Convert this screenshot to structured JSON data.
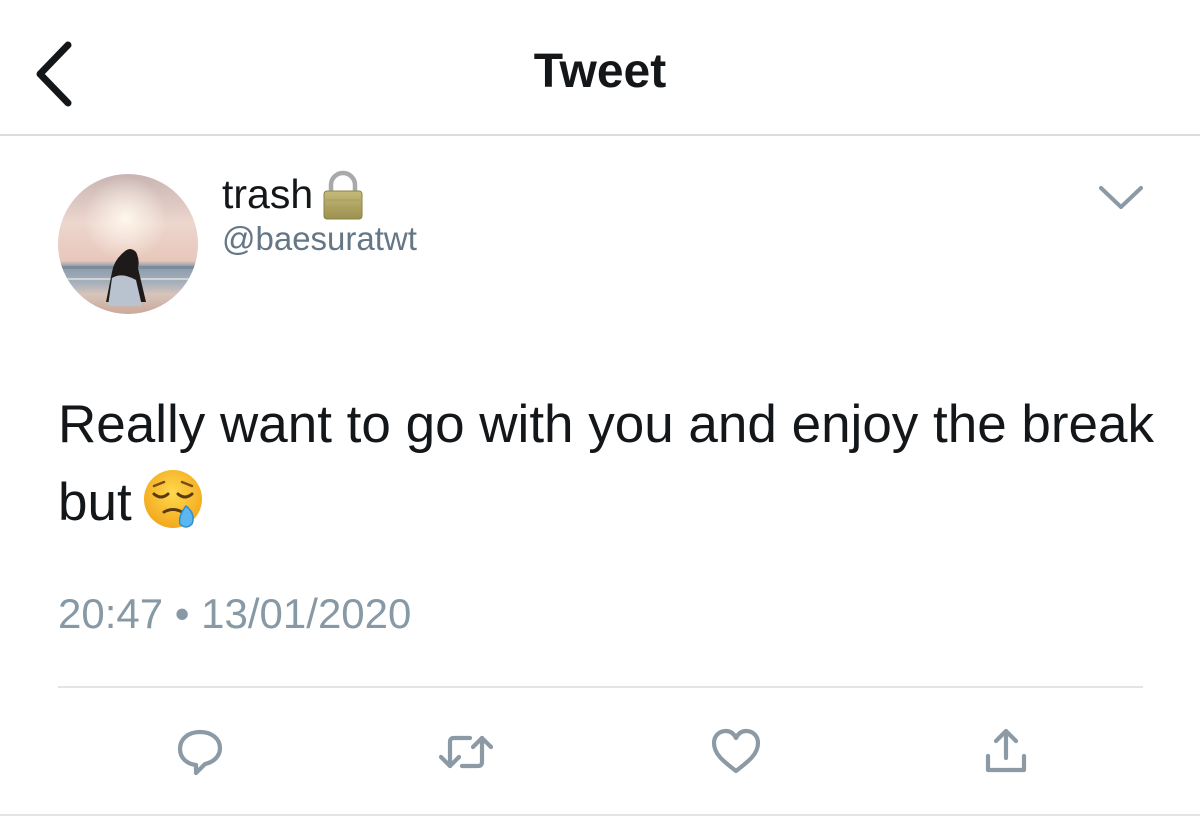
{
  "header": {
    "title": "Tweet",
    "back_icon": "chevron-left-icon"
  },
  "tweet": {
    "display_name": "trash",
    "protected_icon": "lock-icon",
    "handle": "@baesuratwt",
    "text": "Really want to go with you and enjoy the break but",
    "emoji": "sleepy-face-emoji",
    "time": "20:47",
    "separator": "•",
    "date": "13/01/2020",
    "menu_icon": "chevron-down-icon"
  },
  "actions": [
    {
      "name": "reply",
      "icon": "reply-icon"
    },
    {
      "name": "retweet",
      "icon": "retweet-icon"
    },
    {
      "name": "like",
      "icon": "heart-icon"
    },
    {
      "name": "share",
      "icon": "share-icon"
    }
  ],
  "colors": {
    "text_primary": "#14171a",
    "text_secondary": "#657786",
    "timestamp": "#8899a6",
    "icon_gray": "#8c9aa6",
    "divider": "#e1e5e8"
  }
}
